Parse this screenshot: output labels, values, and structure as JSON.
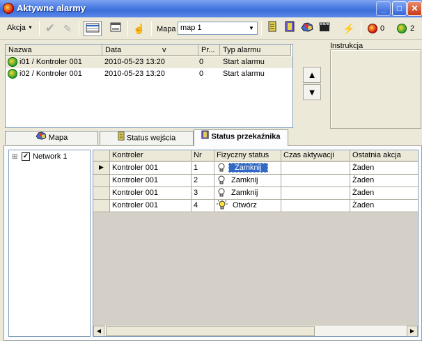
{
  "window": {
    "title": "Aktywne alarmy",
    "min": "_",
    "max": "□",
    "close": "✕"
  },
  "toolbar": {
    "akcja_label": "Akcja",
    "mapa_label": "Mapa",
    "map_value": "map 1",
    "alarm_count_red": "0",
    "alarm_count_green": "2"
  },
  "alarms_table": {
    "headers": [
      "Nazwa",
      "Data",
      "v",
      "Pr...",
      "Typ alarmu"
    ],
    "rows": [
      {
        "name": "i01 / Kontroler 001",
        "date": "2010-05-23 13:20",
        "priority": "0",
        "type": "Start alarmu"
      },
      {
        "name": "i02 / Kontroler 001",
        "date": "2010-05-23 13:20",
        "priority": "0",
        "type": "Start alarmu"
      }
    ]
  },
  "instruction": {
    "label": "Instrukcja"
  },
  "nav": {
    "up": "▲",
    "down": "▼"
  },
  "tabs": [
    {
      "label": "Mapa"
    },
    {
      "label": "Status wejścia"
    },
    {
      "label": "Status przekaźnika"
    }
  ],
  "tree": {
    "root_label": "Network 1",
    "expander": "⊞"
  },
  "relay_grid": {
    "headers": [
      "Kontroler",
      "Nr",
      "Fizyczny status",
      "Czas aktywacji",
      "Ostatnia akcja"
    ],
    "rows": [
      {
        "controller": "Kontroler 001",
        "nr": "1",
        "status": "Zamknij",
        "time": "",
        "last": "Żaden"
      },
      {
        "controller": "Kontroler 001",
        "nr": "2",
        "status": "Zamknij",
        "time": "",
        "last": "Żaden"
      },
      {
        "controller": "Kontroler 001",
        "nr": "3",
        "status": "Zamknij",
        "time": "",
        "last": "Żaden"
      },
      {
        "controller": "Kontroler 001",
        "nr": "4",
        "status": "Otwórz",
        "time": "",
        "last": "Żaden"
      }
    ]
  },
  "colors": {
    "titlebar": "#3d6fd9",
    "selection": "#316ac5",
    "panel": "#ece9d8"
  }
}
